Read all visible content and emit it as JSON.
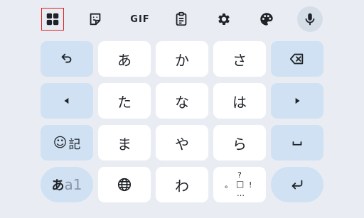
{
  "toolbar": {
    "gif_label": "GIF",
    "icons": [
      "apps-icon",
      "sticker-icon",
      "gif-icon",
      "clipboard-icon",
      "settings-icon",
      "palette-icon",
      "mic-icon"
    ],
    "highlight_color": "#e02020"
  },
  "keys": {
    "row0": [
      "あ",
      "か",
      "さ"
    ],
    "row1": [
      "た",
      "な",
      "は"
    ],
    "row2": [
      "ま",
      "や",
      "ら"
    ],
    "row3": [
      "わ"
    ]
  },
  "emoji_key": {
    "smile": "☺",
    "kanji": "記"
  },
  "mode_key": {
    "current": "あ",
    "alt": "a1"
  },
  "punct_key": {
    "top": "?",
    "left": "。",
    "center": "□",
    "right": "!",
    "bottom": "…"
  },
  "colors": {
    "background": "#e9edf3",
    "key": "#ffffff",
    "function_key": "#cfe1f2",
    "text": "#1f2328"
  }
}
